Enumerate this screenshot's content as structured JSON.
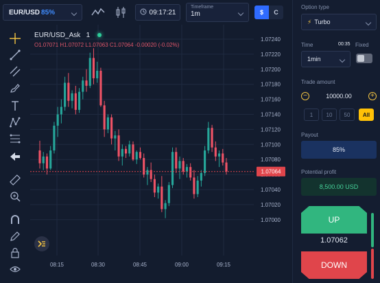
{
  "toolbar": {
    "symbol": "EUR/USD",
    "symbol_pct": "85%",
    "time": "09:17:21",
    "timeframe_label": "Timeframe",
    "timeframe_value": "1m",
    "currency_active": "$",
    "currency_inactive": "C"
  },
  "chart": {
    "title": "EUR/USD_Ask",
    "interval": "1",
    "ohlc": "O1.07071  H1.07072  L1.07063  C1.07064  -0.00020  (-0.02%)",
    "current_price": "1.07064",
    "colors": {
      "up": "#26a69a",
      "down": "#ef5366",
      "price_line": "#e0454b"
    }
  },
  "chart_data": {
    "type": "candlestick",
    "y_ticks": [
      "1.07240",
      "1.07220",
      "1.07200",
      "1.07180",
      "1.07160",
      "1.07140",
      "1.07120",
      "1.07100",
      "1.07080",
      "1.07060",
      "1.07040",
      "1.07020",
      "1.07000"
    ],
    "x_ticks": [
      "08:15",
      "08:30",
      "08:45",
      "09:00",
      "09:15"
    ],
    "ylim": [
      1.0699,
      1.0725
    ],
    "candles": [
      [
        1.07092,
        1.07105,
        1.07068,
        1.07075
      ],
      [
        1.07075,
        1.0709,
        1.07066,
        1.07084
      ],
      [
        1.07084,
        1.07088,
        1.0706,
        1.07068
      ],
      [
        1.07068,
        1.07098,
        1.07066,
        1.07092
      ],
      [
        1.07092,
        1.0713,
        1.07088,
        1.07125
      ],
      [
        1.07125,
        1.0715,
        1.0711,
        1.0714
      ],
      [
        1.0714,
        1.0716,
        1.07128,
        1.0715
      ],
      [
        1.0715,
        1.0719,
        1.07145,
        1.07182
      ],
      [
        1.07182,
        1.07195,
        1.0715,
        1.07158
      ],
      [
        1.07158,
        1.07172,
        1.07148,
        1.07168
      ],
      [
        1.07168,
        1.07178,
        1.0714,
        1.07146
      ],
      [
        1.07146,
        1.07175,
        1.07142,
        1.0717
      ],
      [
        1.0717,
        1.0719,
        1.0716,
        1.07185
      ],
      [
        1.07185,
        1.072,
        1.0717,
        1.07178
      ],
      [
        1.07178,
        1.07222,
        1.07175,
        1.07215
      ],
      [
        1.07215,
        1.07228,
        1.0718,
        1.07188
      ],
      [
        1.07188,
        1.0721,
        1.07182,
        1.07198
      ],
      [
        1.07198,
        1.07202,
        1.0715,
        1.07152
      ],
      [
        1.07152,
        1.07158,
        1.0711,
        1.0712
      ],
      [
        1.0712,
        1.0714,
        1.07115,
        1.07136
      ],
      [
        1.07136,
        1.0714,
        1.071,
        1.07108
      ],
      [
        1.07108,
        1.07118,
        1.07092,
        1.07112
      ],
      [
        1.07112,
        1.0712,
        1.07078,
        1.07084
      ],
      [
        1.07084,
        1.071,
        1.07072,
        1.07094
      ],
      [
        1.07094,
        1.07098,
        1.07082,
        1.07088
      ],
      [
        1.07088,
        1.07105,
        1.07084,
        1.071
      ],
      [
        1.071,
        1.07104,
        1.07078,
        1.0708
      ],
      [
        1.0708,
        1.07092,
        1.07074,
        1.0709
      ],
      [
        1.0709,
        1.07096,
        1.0708,
        1.07082
      ],
      [
        1.07082,
        1.07088,
        1.07056,
        1.0706
      ],
      [
        1.0706,
        1.0707,
        1.07046,
        1.07066
      ],
      [
        1.07066,
        1.07076,
        1.0705,
        1.07054
      ],
      [
        1.07054,
        1.0706,
        1.0703,
        1.07036
      ],
      [
        1.07036,
        1.07048,
        1.07028,
        1.07044
      ],
      [
        1.07044,
        1.07058,
        1.0701,
        1.07014
      ],
      [
        1.07014,
        1.07026,
        1.07002,
        1.07022
      ],
      [
        1.07022,
        1.0705,
        1.07018,
        1.07046
      ],
      [
        1.07046,
        1.07096,
        1.07042,
        1.0709
      ],
      [
        1.0709,
        1.07096,
        1.07062,
        1.07068
      ],
      [
        1.07068,
        1.07084,
        1.07054,
        1.07078
      ],
      [
        1.07078,
        1.07082,
        1.0706,
        1.07064
      ],
      [
        1.07064,
        1.07074,
        1.07056,
        1.0707
      ],
      [
        1.0707,
        1.07075,
        1.07052,
        1.07056
      ],
      [
        1.07056,
        1.07066,
        1.07028,
        1.07034
      ],
      [
        1.07034,
        1.07058,
        1.0703,
        1.07052
      ],
      [
        1.07052,
        1.07066,
        1.07044,
        1.07062
      ],
      [
        1.07062,
        1.07098,
        1.07058,
        1.07092
      ],
      [
        1.07092,
        1.0713,
        1.07088,
        1.07122
      ],
      [
        1.07122,
        1.07126,
        1.0709,
        1.07096
      ],
      [
        1.07096,
        1.07104,
        1.07078,
        1.07084
      ],
      [
        1.07084,
        1.07092,
        1.0707,
        1.07088
      ],
      [
        1.07088,
        1.07094,
        1.07072,
        1.07076
      ],
      [
        1.07076,
        1.07082,
        1.0706,
        1.07064
      ]
    ]
  },
  "panel": {
    "option_type_label": "Option type",
    "option_type_value": "Turbo",
    "time_label": "Time",
    "time_countdown": "00:35",
    "fixed_label": "Fixed",
    "time_value": "1min",
    "amount_label": "Trade amount",
    "amount_value": "10000.00",
    "presets": [
      "1",
      "10",
      "50",
      "All"
    ],
    "payout_label": "Payout",
    "payout_value": "85%",
    "profit_label": "Potential profit",
    "profit_value": "8,500.00 USD",
    "up_label": "UP",
    "down_label": "DOWN",
    "current_price": "1.07062"
  }
}
